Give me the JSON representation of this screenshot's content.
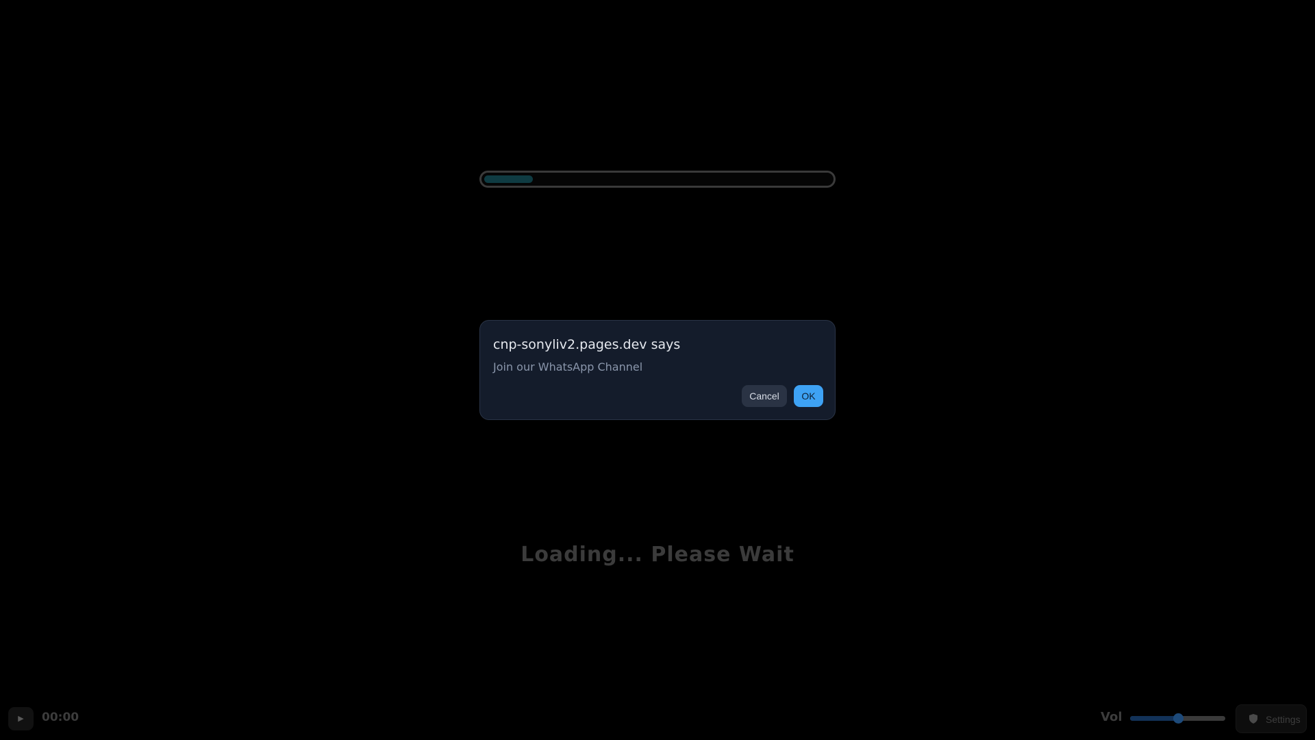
{
  "loading_bar": {
    "progress_fraction": 0.14
  },
  "dialog": {
    "title": "cnp-sonyliv2.pages.dev says",
    "message": "Join our WhatsApp Channel",
    "cancel_label": "Cancel",
    "ok_label": "OK"
  },
  "status": {
    "loading_text": "Loading... Please Wait"
  },
  "player_controls": {
    "play_icon": "play-icon",
    "play_glyph": "▶",
    "time": "00:00",
    "volume_label": "Vol",
    "volume_fraction": 0.5,
    "settings_icon": "shield-icon",
    "settings_label": "Settings"
  },
  "colors": {
    "background": "#000000",
    "dialog_bg": "#141c2b",
    "ok_button": "#3ea2f4",
    "cancel_button": "#2a3344",
    "progress_fill": "#0f3b42",
    "volume_fill": "#123258"
  }
}
